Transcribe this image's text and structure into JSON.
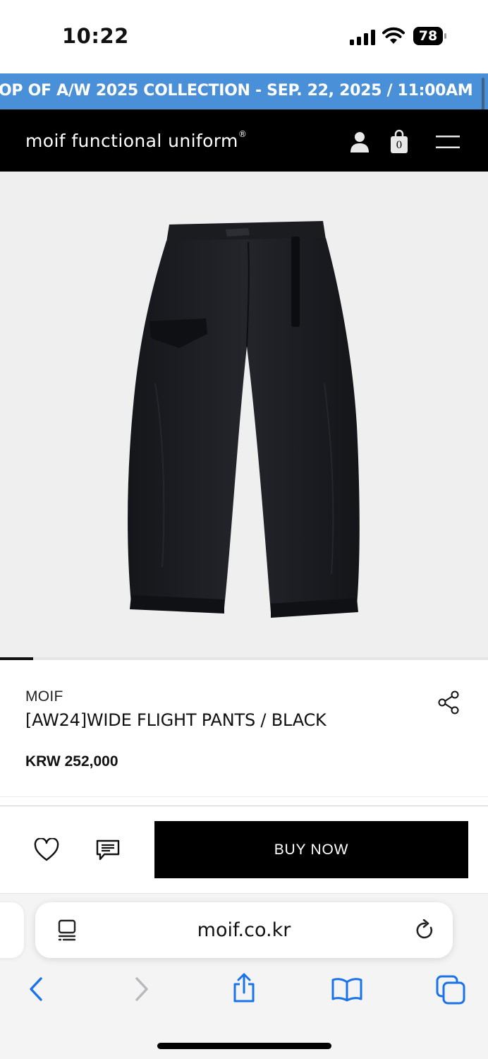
{
  "status_bar": {
    "time": "10:22",
    "battery": "78"
  },
  "announcement": {
    "text": "OP OF A/W 2025 COLLECTION - SEP. 22, 2025 / 11:00AM",
    "background_color": "#4a90d9"
  },
  "header": {
    "brand": "moif functional uniform",
    "brand_mark": "®",
    "cart_count": "0",
    "icons": [
      "user-icon",
      "bag-icon",
      "menu-icon"
    ]
  },
  "carousel": {
    "current_slide_fraction": 0.068
  },
  "product": {
    "brand": "MOIF",
    "name": "[AW24]WIDE FLIGHT PANTS / BLACK",
    "price": "KRW 252,000"
  },
  "actions": {
    "buy_label": "BUY NOW",
    "icons": [
      "heart-icon",
      "review-icon",
      "share-icon"
    ]
  },
  "browser": {
    "url": "moif.co.kr",
    "toolbar_icons": [
      "back-icon",
      "forward-icon",
      "share-icon",
      "bookmarks-icon",
      "tabs-icon"
    ],
    "accent_color": "#1a73e8"
  }
}
